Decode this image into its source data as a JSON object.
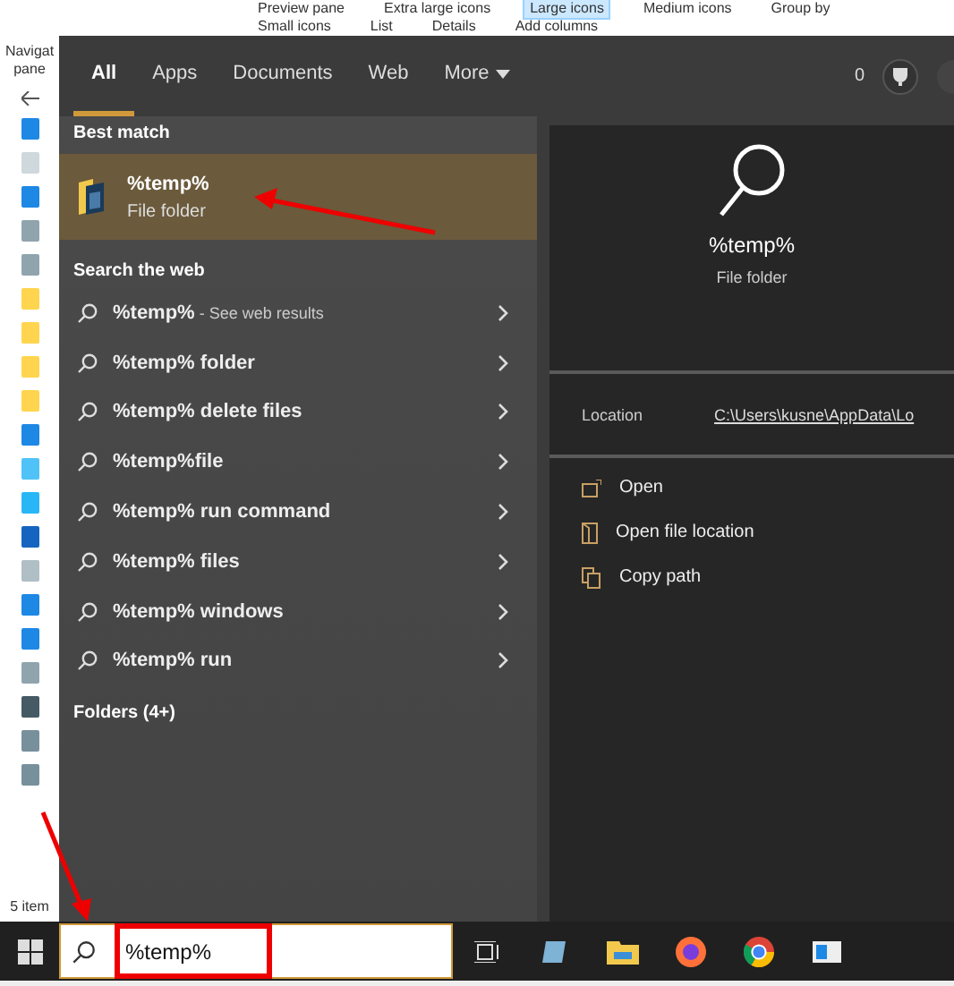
{
  "ribbon": {
    "row_1": [
      {
        "label": "Preview pane",
        "selected": false
      },
      {
        "label": "Extra large icons",
        "selected": false
      },
      {
        "label": "Large icons",
        "selected": true
      },
      {
        "label": "Medium icons",
        "selected": false
      },
      {
        "label": "Group by",
        "selected": false
      }
    ],
    "row_2": [
      {
        "label": "Small icons",
        "selected": false
      },
      {
        "label": "List",
        "selected": false
      },
      {
        "label": "Details",
        "selected": false
      },
      {
        "label": "Add columns",
        "selected": false
      }
    ]
  },
  "explorer": {
    "pane_label": "Navigat pane",
    "status": "5 item"
  },
  "search": {
    "tabs": [
      {
        "label": "All",
        "selected": true
      },
      {
        "label": "Apps",
        "selected": false
      },
      {
        "label": "Documents",
        "selected": false
      },
      {
        "label": "Web",
        "selected": false
      },
      {
        "label": "More",
        "selected": false
      }
    ],
    "points": "0",
    "best_match_header": "Best match",
    "best_match": {
      "title": "%temp%",
      "subtitle": "File folder",
      "selected": true
    },
    "web_header": "Search the web",
    "web_results": [
      {
        "text": "%temp%",
        "note": " - See web results"
      },
      {
        "text": "%temp% folder"
      },
      {
        "text": "%temp% delete files"
      },
      {
        "text": "%temp%file"
      },
      {
        "text": "%temp% run command"
      },
      {
        "text": "%temp% files"
      },
      {
        "text": "%temp% windows"
      },
      {
        "text": "%temp% run"
      }
    ],
    "folders_header": "Folders (4+)",
    "preview": {
      "title": "%temp%",
      "subtitle": "File folder",
      "location_label": "Location",
      "location_value": "C:\\Users\\kusne\\AppData\\Lo",
      "actions": [
        {
          "label": "Open",
          "kind": "open"
        },
        {
          "label": "Open file location",
          "kind": "location"
        },
        {
          "label": "Copy path",
          "kind": "copy"
        }
      ]
    }
  },
  "taskbar": {
    "search_value": "%temp%"
  }
}
